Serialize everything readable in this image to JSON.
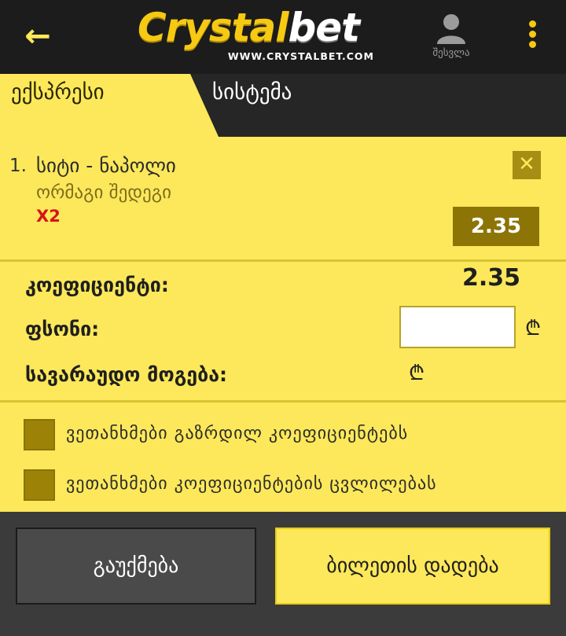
{
  "header": {
    "logo_main": "Crystal",
    "logo_accent": "bet",
    "logo_url": "WWW.CRYSTALBET.COM",
    "login_label": "შესვლა",
    "back_icon": "arrow-left-icon",
    "user_icon": "user-icon",
    "menu_icon": "more-vertical-icon"
  },
  "tabs": [
    {
      "label": "ექსპრესი",
      "active": true
    },
    {
      "label": "სისტემა",
      "active": false
    }
  ],
  "bets": [
    {
      "index": "1.",
      "match": "სიტი - ნაპოლი",
      "market": "ორმაგი შედეგი",
      "pick": "X2",
      "odds": "2.35"
    }
  ],
  "summary": {
    "coef_label": "კოეფიციენტი:",
    "coef_value": "2.35",
    "stake_label": "ფსონი:",
    "stake_value": "",
    "win_label": "სავარაუდო მოგება:",
    "currency": "₾"
  },
  "options": [
    {
      "label": "ვეთანხმები გაზრდილ კოეფიციენტებს",
      "checked": false
    },
    {
      "label": "ვეთანხმები კოეფიციენტების ცვლილებას",
      "checked": false
    }
  ],
  "actions": {
    "clear_label": "გაუქმება",
    "place_label": "ბილეთის დადება"
  },
  "colors": {
    "brand_yellow": "#fce85a",
    "dark": "#1c1c1c",
    "olive": "#8c7506",
    "pick_red": "#d6131a"
  }
}
